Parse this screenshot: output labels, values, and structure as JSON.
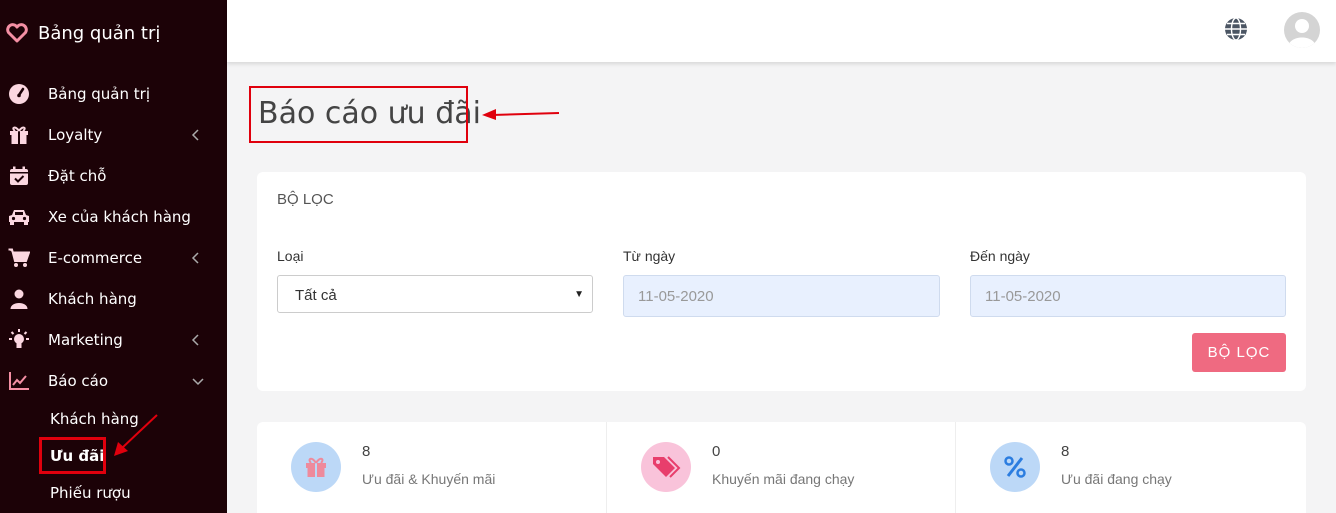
{
  "app": {
    "title": "Bảng quản trị"
  },
  "sidebar": {
    "items": [
      {
        "label": "Bảng quản trị",
        "icon": "dashboard-icon"
      },
      {
        "label": "Loyalty",
        "icon": "gift-icon"
      },
      {
        "label": "Đặt chỗ",
        "icon": "calendar-check-icon"
      },
      {
        "label": "Xe của khách hàng",
        "icon": "car-icon"
      },
      {
        "label": "E-commerce",
        "icon": "cart-icon"
      },
      {
        "label": "Khách hàng",
        "icon": "user-icon"
      },
      {
        "label": "Marketing",
        "icon": "bulb-icon"
      },
      {
        "label": "Báo cáo",
        "icon": "chart-icon"
      }
    ],
    "sub_items": [
      {
        "label": "Khách hàng"
      },
      {
        "label": "Ưu đãi"
      },
      {
        "label": "Phiếu rượu"
      }
    ]
  },
  "page": {
    "title": "Báo cáo ưu đãi"
  },
  "filter": {
    "header": "BỘ LỌC",
    "type_label": "Loại",
    "type_value": "Tất cả",
    "from_label": "Từ ngày",
    "from_value": "11-05-2020",
    "to_label": "Đến ngày",
    "to_value": "11-05-2020",
    "button": "BỘ LỌC"
  },
  "stats": [
    {
      "value": "8",
      "label": "Ưu đãi & Khuyến mãi",
      "icon": "gift-icon",
      "color": "#bcd8f7"
    },
    {
      "value": "0",
      "label": "Khuyến mãi đang chạy",
      "icon": "tags-icon",
      "color": "#f9c3da"
    },
    {
      "value": "8",
      "label": "Ưu đãi đang chạy",
      "icon": "percent-icon",
      "color": "#bcd8f7"
    }
  ],
  "colors": {
    "sidebar": "#1c0207",
    "accent": "#ef6a81",
    "brand": "#f07a90",
    "annotation": "#e0000d"
  }
}
